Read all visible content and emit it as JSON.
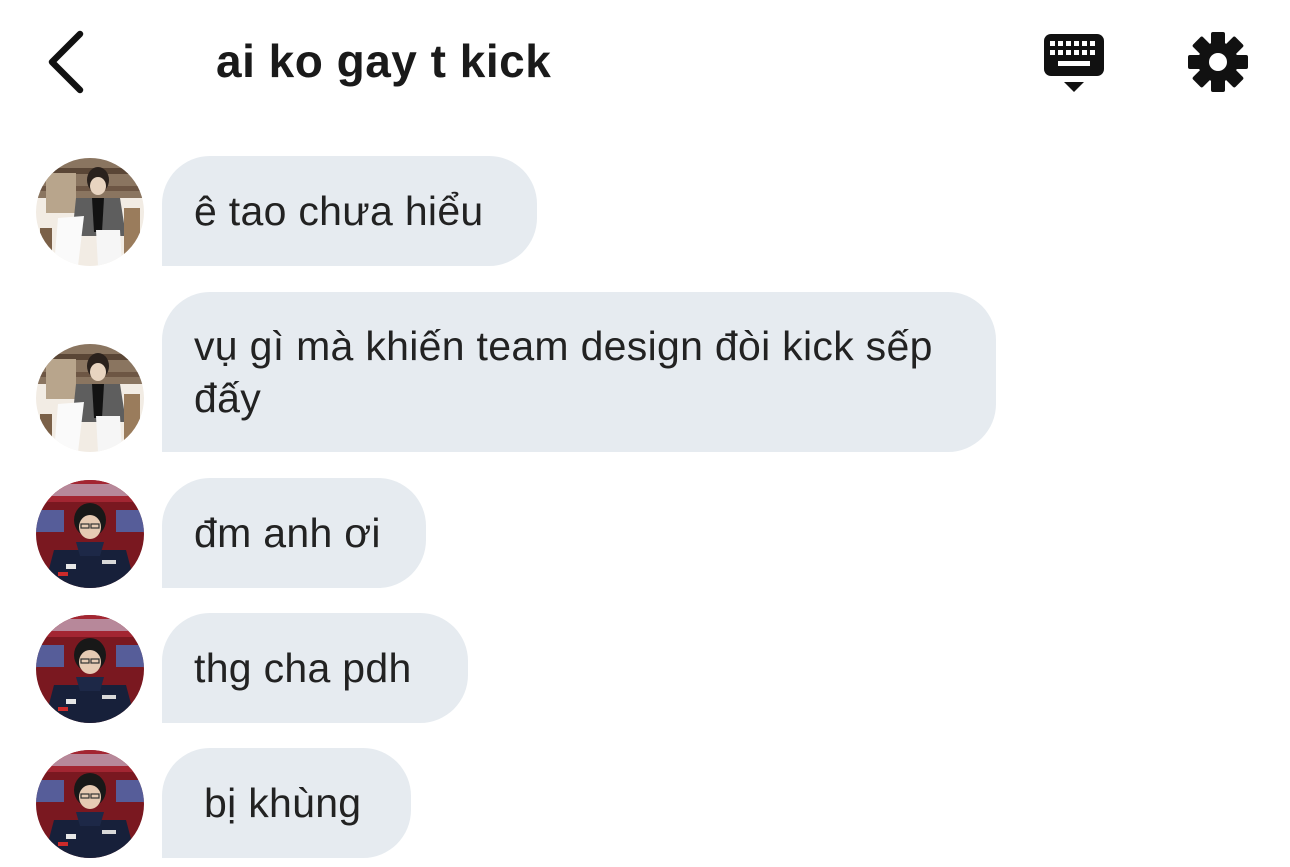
{
  "header": {
    "title": "ai ko gay t kick",
    "back_icon": "chevron-left-icon",
    "keyboard_icon": "keyboard-icon",
    "settings_icon": "gear-icon"
  },
  "messages": [
    {
      "sender": "user-a",
      "text": "ê tao chưa hiểu"
    },
    {
      "sender": "user-a",
      "text": "vụ gì mà khiến team design đòi kick sếp đấy"
    },
    {
      "sender": "user-b",
      "text": "đm anh ơi"
    },
    {
      "sender": "user-b",
      "text": "thg cha pdh"
    },
    {
      "sender": "user-b",
      "text": "bị khùng"
    }
  ],
  "colors": {
    "bubble": "#e6ebf0",
    "text": "#222222",
    "background": "#ffffff"
  }
}
